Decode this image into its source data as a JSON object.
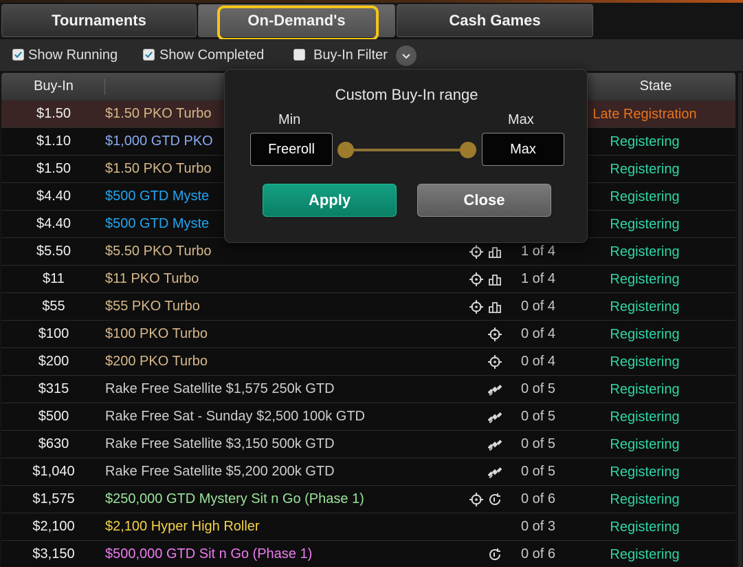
{
  "tabs": [
    {
      "label": "Tournaments"
    },
    {
      "label": "On-Demand's"
    },
    {
      "label": "Cash Games"
    }
  ],
  "filters": {
    "show_running": "Show Running",
    "show_completed": "Show Completed",
    "buyin_filter": "Buy-In Filter"
  },
  "table": {
    "headers": {
      "buyin": "Buy-In",
      "state": "State"
    },
    "rows": [
      {
        "buyin": "$1.50",
        "name": "$1.50 PKO Turbo",
        "players": "",
        "state": "Late Registration"
      },
      {
        "buyin": "$1.10",
        "name": "$1,000 GTD PKO",
        "players": "",
        "state": "Registering"
      },
      {
        "buyin": "$1.50",
        "name": "$1.50 PKO Turbo",
        "players": "",
        "state": "Registering"
      },
      {
        "buyin": "$4.40",
        "name": "$500 GTD Myste",
        "players": "",
        "state": "Registering"
      },
      {
        "buyin": "$4.40",
        "name": "$500 GTD Myste",
        "players": "",
        "state": "Registering"
      },
      {
        "buyin": "$5.50",
        "name": "$5.50 PKO Turbo",
        "players": "1 of 4",
        "state": "Registering"
      },
      {
        "buyin": "$11",
        "name": "$11 PKO Turbo",
        "players": "1 of 4",
        "state": "Registering"
      },
      {
        "buyin": "$55",
        "name": "$55 PKO Turbo",
        "players": "0 of 4",
        "state": "Registering"
      },
      {
        "buyin": "$100",
        "name": "$100 PKO Turbo",
        "players": "0 of 4",
        "state": "Registering"
      },
      {
        "buyin": "$200",
        "name": "$200 PKO Turbo",
        "players": "0 of 4",
        "state": "Registering"
      },
      {
        "buyin": "$315",
        "name": "Rake Free Satellite $1,575 250k GTD",
        "players": "0 of 5",
        "state": "Registering"
      },
      {
        "buyin": "$500",
        "name": "Rake Free Sat - Sunday $2,500 100k GTD",
        "players": "0 of 5",
        "state": "Registering"
      },
      {
        "buyin": "$630",
        "name": "Rake Free Satellite $3,150 500k GTD",
        "players": "0 of 5",
        "state": "Registering"
      },
      {
        "buyin": "$1,040",
        "name": "Rake Free Satellite $5,200 200k GTD",
        "players": "0 of 5",
        "state": "Registering"
      },
      {
        "buyin": "$1,575",
        "name": "$250,000 GTD Mystery Sit n Go (Phase 1)",
        "players": "0 of 6",
        "state": "Registering"
      },
      {
        "buyin": "$2,100",
        "name": "$2,100 Hyper High Roller",
        "players": "0 of 3",
        "state": "Registering"
      },
      {
        "buyin": "$3,150",
        "name": "$500,000 GTD Sit n Go (Phase 1)",
        "players": "0 of 6",
        "state": "Registering"
      }
    ]
  },
  "popup": {
    "title": "Custom Buy-In range",
    "min_label": "Min",
    "max_label": "Max",
    "min_value": "Freeroll",
    "max_value": "Max",
    "apply": "Apply",
    "close": "Close"
  },
  "colors": {
    "accent_highlight": "#f5c518",
    "registering": "#2fd6a8",
    "late_registration": "#e8741c",
    "apply": "#0a8f70"
  }
}
